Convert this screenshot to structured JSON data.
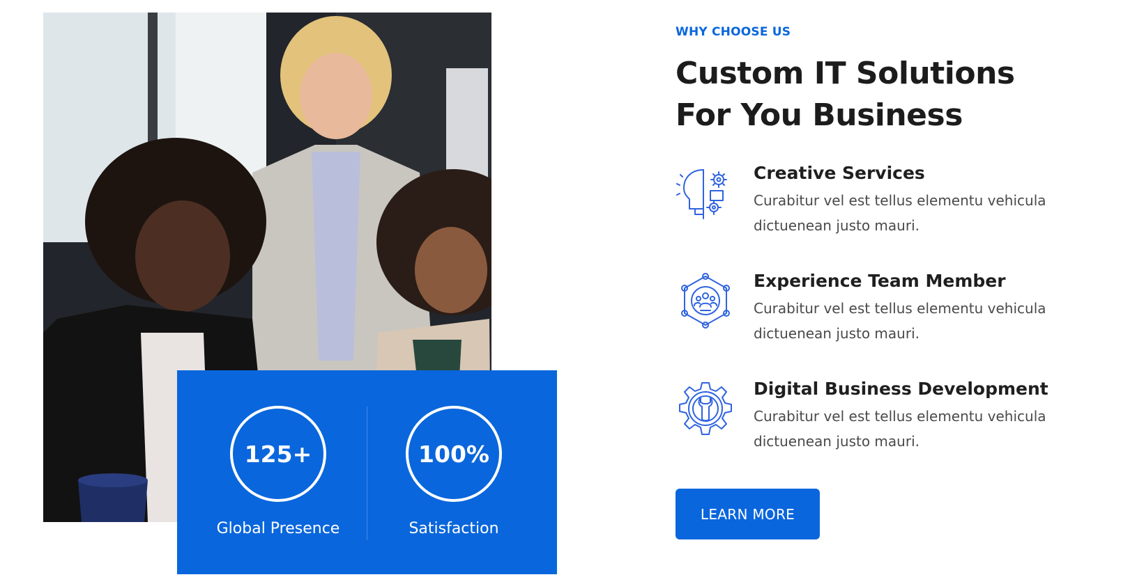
{
  "brand_color": "#0a66dc",
  "photo": {
    "description_icon": "team-photo"
  },
  "stats": [
    {
      "value": "125+",
      "label": "Global Presence"
    },
    {
      "value": "100%",
      "label": "Satisfaction"
    }
  ],
  "section": {
    "eyebrow": "WHY CHOOSE US",
    "title_line1": "Custom IT Solutions",
    "title_line2": "For You Business"
  },
  "features": [
    {
      "icon": "creative-head-gears-icon",
      "title": "Creative Services",
      "desc_line1": "Curabitur vel est tellus elementu vehicula",
      "desc_line2": "dictuenean justo mauri."
    },
    {
      "icon": "team-network-icon",
      "title": "Experience Team Member",
      "desc_line1": "Curabitur vel est tellus elementu vehicula",
      "desc_line2": "dictuenean justo mauri."
    },
    {
      "icon": "gear-wrench-icon",
      "title": "Digital Business Development",
      "desc_line1": "Curabitur vel est tellus elementu vehicula",
      "desc_line2": "dictuenean justo mauri."
    }
  ],
  "cta": {
    "label": "LEARN MORE"
  }
}
